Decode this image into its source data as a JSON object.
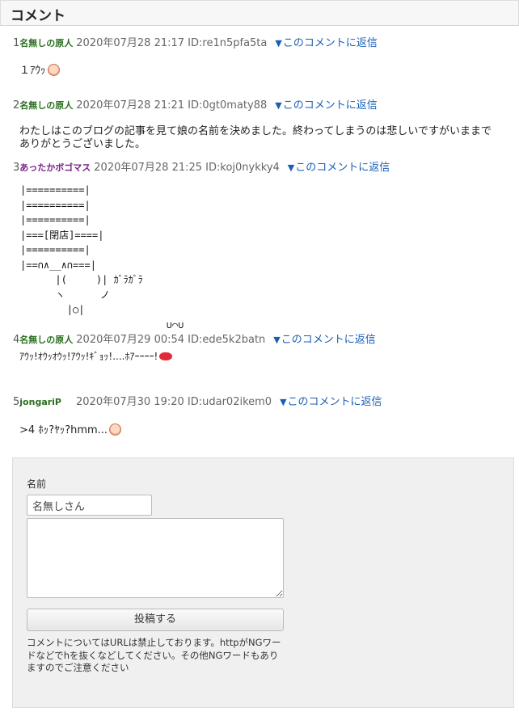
{
  "header": {
    "title": "コメント"
  },
  "comments": [
    {
      "num": "1",
      "author": "名無しの原人",
      "date": "2020年07月28 21:17 ID:re1n5pfa5ta",
      "reply": "このコメントに返信",
      "body": "１ｱｳｯ",
      "emoji": "face-icon"
    },
    {
      "num": "2",
      "author": "名無しの原人",
      "date": "2020年07月28 21:21 ID:0gt0maty88",
      "reply": "このコメントに返信",
      "body": "わたしはこのブログの記事を見て娘の名前を決めました。終わってしまうのは悲しいですがいままでありがとうございました。"
    },
    {
      "num": "3",
      "author": "あったかボゴマス",
      "date": "2020年07月28 21:25 ID:koj0nykky4",
      "reply": "このコメントに返信",
      "aa": "|==========|\n|==========|\n|==========|\n|===[閉店]====|\n|==========|\n|==∩∧__∧∩===|\n      |(     )| ｶﾞﾗｶﾞﾗ\n      ヽ      ノ\n        |○|\n                         ∪⌒∪"
    },
    {
      "num": "4",
      "author": "名無しの原人",
      "date": "2020年07月29 00:54 ID:ede5k2batn",
      "reply": "このコメントに返信",
      "body": "ｱｳｯ!ｵｳｯｵｳｯ!ｱｳｯ!ｷﾞｮｯ!....ﾎｱｰｰｰｰ!",
      "emoji": "lips-icon"
    },
    {
      "num": "5",
      "author": "jongariP",
      "date": "2020年07月30 19:20 ID:udar02ikem0",
      "reply": "このコメントに返信",
      "body": ">4 ﾎｯ?ﾔｯ?hmm...",
      "emoji": "face-icon"
    }
  ],
  "form": {
    "name_label": "名前",
    "name_value": "名無しさん",
    "body_value": "",
    "submit_label": "投稿する",
    "note": "コメントについてはURLは禁止しております。httpがNGワードなどでhを抜くなどしてください。その他NGワードもありますのでご注意ください"
  },
  "colors": {
    "reply_link": "#1a5fb4",
    "author_green": "#2a6e1f",
    "author_purple": "#7a1f86"
  }
}
